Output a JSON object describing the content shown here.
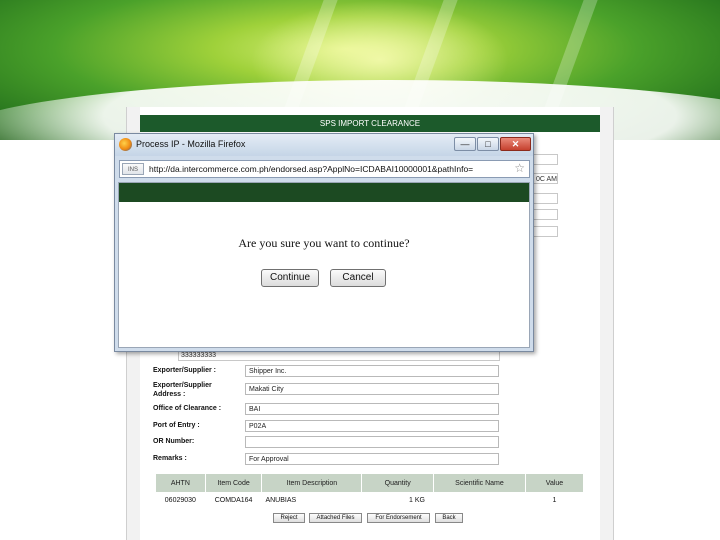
{
  "page": {
    "title": "SPS IMPORT CLEARANCE",
    "permit_no_fragment": "333333333",
    "time_fragment": "0C AM",
    "form": [
      {
        "label": "Exporter/Supplier :",
        "value": "Shipper Inc."
      },
      {
        "label": "Exporter/Supplier Address :",
        "value": "Makati City"
      },
      {
        "label": "Office of Clearance :",
        "value": "BAI"
      },
      {
        "label": "Port of Entry :",
        "value": "P02A"
      },
      {
        "label": "OR Number:",
        "value": ""
      },
      {
        "label": "Remarks :",
        "value": "For Approval"
      }
    ],
    "table": {
      "headers": [
        "AHTN",
        "Item Code",
        "Item Description",
        "Quantity",
        "Scientific Name",
        "Value"
      ],
      "rows": [
        [
          "06029030",
          "COMDA164",
          "ANUBIAS",
          "1 KG",
          "",
          "1"
        ]
      ]
    },
    "buttons": [
      "Reject",
      "Attached Files",
      "For Endorsement",
      "Back"
    ]
  },
  "popup": {
    "window_title": "Process IP - Mozilla Firefox",
    "url": "http://da.intercommerce.com.ph/endorsed.asp?ApplNo=ICDABAI10000001&pathInfo=",
    "site_label": "INS",
    "star": "☆",
    "question": "Are you sure you want to continue?",
    "continue_label": "Continue",
    "cancel_label": "Cancel",
    "minimize": "—",
    "maximize": "□",
    "close": "✕"
  }
}
